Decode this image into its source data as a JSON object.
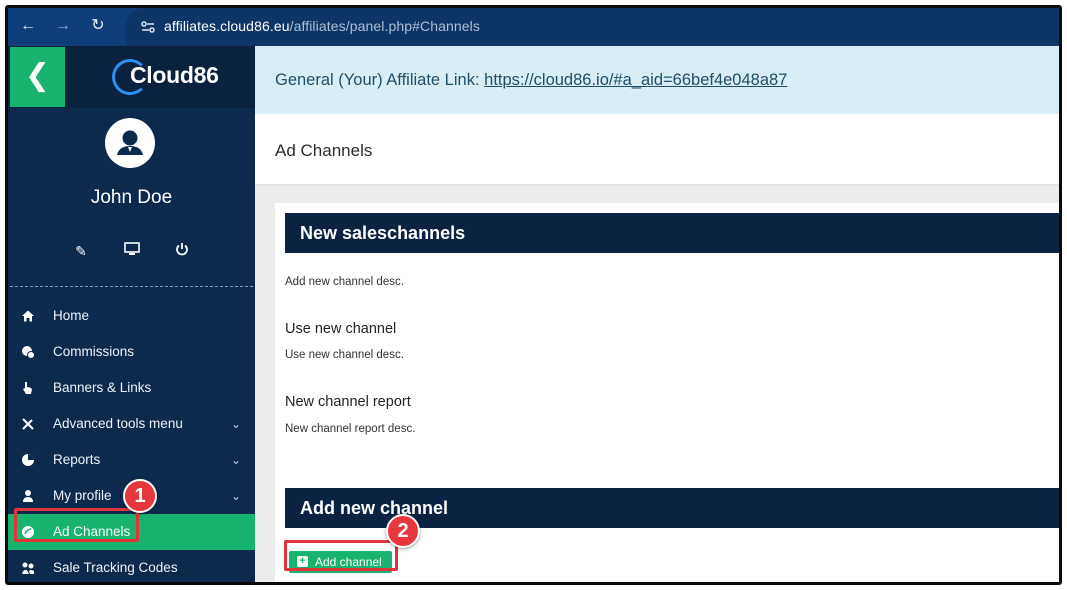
{
  "browser": {
    "url_domain": "affiliates.cloud86.eu",
    "url_path": "/affiliates/panel.php#Channels"
  },
  "sidebar": {
    "logo_text": "Cloud86",
    "user_name": "John Doe",
    "items": [
      {
        "label": "Home",
        "icon": "home-icon",
        "chevron": false
      },
      {
        "label": "Commissions",
        "icon": "coins-icon",
        "chevron": false
      },
      {
        "label": "Banners & Links",
        "icon": "hand-pointer-icon",
        "chevron": false
      },
      {
        "label": "Advanced tools menu",
        "icon": "tools-icon",
        "chevron": true
      },
      {
        "label": "Reports",
        "icon": "pie-chart-icon",
        "chevron": true
      },
      {
        "label": "My profile",
        "icon": "user-icon",
        "chevron": true
      },
      {
        "label": "Ad Channels",
        "icon": "ad-channel-icon",
        "chevron": false,
        "active": true
      },
      {
        "label": "Sale Tracking Codes",
        "icon": "tracking-icon",
        "chevron": false
      }
    ]
  },
  "main": {
    "affiliate_label": "General (Your) Affiliate Link:",
    "affiliate_link": "https://cloud86.io/#a_aid=66bef4e048a87",
    "page_title": "Ad Channels",
    "new_section_title": "New saleschannels",
    "new_section_desc": "Add new channel desc.",
    "use_title": "Use new channel",
    "use_desc": "Use new channel desc.",
    "report_title": "New channel report",
    "report_desc": "New channel report desc.",
    "add_section_title": "Add new channel",
    "add_button_label": "Add channel"
  },
  "annotations": {
    "badge_1": "1",
    "badge_2": "2",
    "color": "#e8363d"
  },
  "colors": {
    "accent_green": "#18b36e",
    "sidebar_navy": "#0b2a4e",
    "header_navy": "#0b2242"
  }
}
